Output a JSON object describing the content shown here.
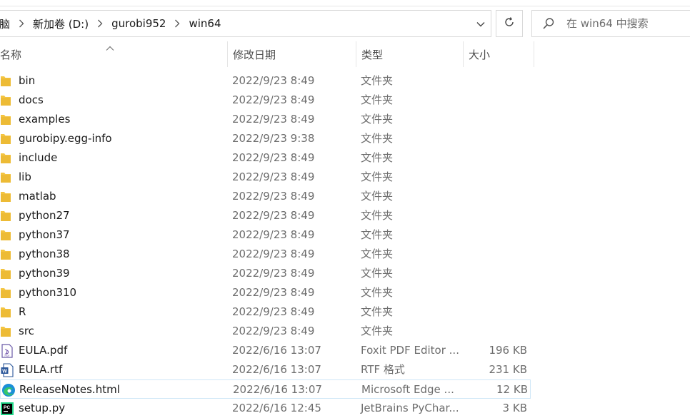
{
  "address": {
    "crumbs": [
      "脑",
      "新加卷 (D:)",
      "gurobi952",
      "win64"
    ]
  },
  "search": {
    "placeholder": "在 win64 中搜索"
  },
  "columns": {
    "name": "名称",
    "date": "修改日期",
    "type": "类型",
    "size": "大小"
  },
  "files": [
    {
      "name": "bin",
      "date": "2022/9/23 8:49",
      "type": "文件夹",
      "size": "",
      "icon": "folder-icon"
    },
    {
      "name": "docs",
      "date": "2022/9/23 8:49",
      "type": "文件夹",
      "size": "",
      "icon": "folder-icon"
    },
    {
      "name": "examples",
      "date": "2022/9/23 8:49",
      "type": "文件夹",
      "size": "",
      "icon": "folder-icon"
    },
    {
      "name": "gurobipy.egg-info",
      "date": "2022/9/23 9:38",
      "type": "文件夹",
      "size": "",
      "icon": "folder-icon"
    },
    {
      "name": "include",
      "date": "2022/9/23 8:49",
      "type": "文件夹",
      "size": "",
      "icon": "folder-icon"
    },
    {
      "name": "lib",
      "date": "2022/9/23 8:49",
      "type": "文件夹",
      "size": "",
      "icon": "folder-icon"
    },
    {
      "name": "matlab",
      "date": "2022/9/23 8:49",
      "type": "文件夹",
      "size": "",
      "icon": "folder-icon"
    },
    {
      "name": "python27",
      "date": "2022/9/23 8:49",
      "type": "文件夹",
      "size": "",
      "icon": "folder-icon"
    },
    {
      "name": "python37",
      "date": "2022/9/23 8:49",
      "type": "文件夹",
      "size": "",
      "icon": "folder-icon"
    },
    {
      "name": "python38",
      "date": "2022/9/23 8:49",
      "type": "文件夹",
      "size": "",
      "icon": "folder-icon"
    },
    {
      "name": "python39",
      "date": "2022/9/23 8:49",
      "type": "文件夹",
      "size": "",
      "icon": "folder-icon"
    },
    {
      "name": "python310",
      "date": "2022/9/23 8:49",
      "type": "文件夹",
      "size": "",
      "icon": "folder-icon"
    },
    {
      "name": "R",
      "date": "2022/9/23 8:49",
      "type": "文件夹",
      "size": "",
      "icon": "folder-icon"
    },
    {
      "name": "src",
      "date": "2022/9/23 8:49",
      "type": "文件夹",
      "size": "",
      "icon": "folder-icon"
    },
    {
      "name": "EULA.pdf",
      "date": "2022/6/16 13:07",
      "type": "Foxit PDF Editor ...",
      "size": "196 KB",
      "icon": "pdf-file-icon"
    },
    {
      "name": "EULA.rtf",
      "date": "2022/6/16 13:07",
      "type": "RTF 格式",
      "size": "231 KB",
      "icon": "word-file-icon"
    },
    {
      "name": "ReleaseNotes.html",
      "date": "2022/6/16 13:07",
      "type": "Microsoft Edge ...",
      "size": "12 KB",
      "icon": "edge-file-icon"
    },
    {
      "name": "setup.py",
      "date": "2022/6/16 12:45",
      "type": "JetBrains PyChar...",
      "size": "3 KB",
      "icon": "pycharm-file-icon"
    }
  ],
  "colors": {
    "folder": "#f4c542",
    "folderDark": "#e0a81e",
    "hover": "#cfe7f7"
  }
}
